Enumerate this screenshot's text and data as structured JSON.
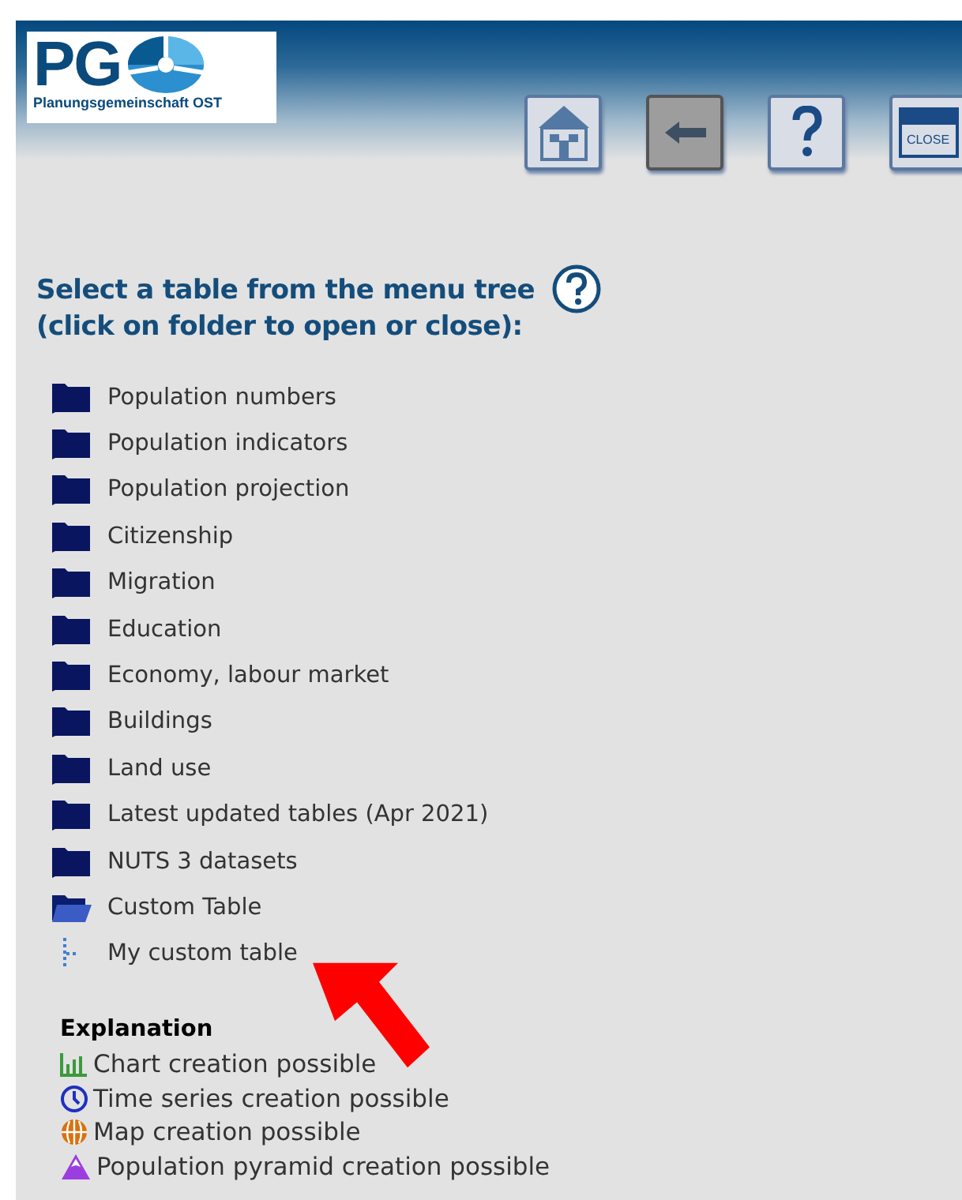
{
  "header": {
    "logo_text": "PG",
    "logo_subtitle": "Planungsgemeinschaft OST",
    "buttons": [
      {
        "kind": "home",
        "disabled": false
      },
      {
        "kind": "back",
        "disabled": true
      },
      {
        "kind": "help",
        "disabled": false
      },
      {
        "kind": "close",
        "label": "CLOSE",
        "disabled": false
      }
    ]
  },
  "heading": {
    "lines": [
      "Select a table from the menu tree",
      "(click on folder to open or close):"
    ]
  },
  "tree": [
    {
      "label": "Population numbers",
      "expanded": false
    },
    {
      "label": "Population indicators",
      "expanded": false
    },
    {
      "label": "Population projection",
      "expanded": false
    },
    {
      "label": "Citizenship",
      "expanded": false
    },
    {
      "label": "Migration",
      "expanded": false
    },
    {
      "label": "Education",
      "expanded": false
    },
    {
      "label": "Economy, labour market",
      "expanded": false
    },
    {
      "label": "Buildings",
      "expanded": false
    },
    {
      "label": "Land use",
      "expanded": false
    },
    {
      "label": "Latest updated tables (Apr 2021)",
      "expanded": false
    },
    {
      "label": "NUTS 3 datasets",
      "expanded": false
    },
    {
      "label": "Custom Table",
      "expanded": true,
      "children": [
        {
          "label": "My custom table"
        }
      ]
    }
  ],
  "explanation": {
    "title": "Explanation",
    "items": [
      {
        "kind": "chart",
        "label": "Chart creation possible"
      },
      {
        "kind": "time",
        "label": "Time series creation possible"
      },
      {
        "kind": "map",
        "label": "Map creation possible"
      },
      {
        "kind": "pyramid",
        "label": "Population pyramid creation possible"
      }
    ]
  }
}
